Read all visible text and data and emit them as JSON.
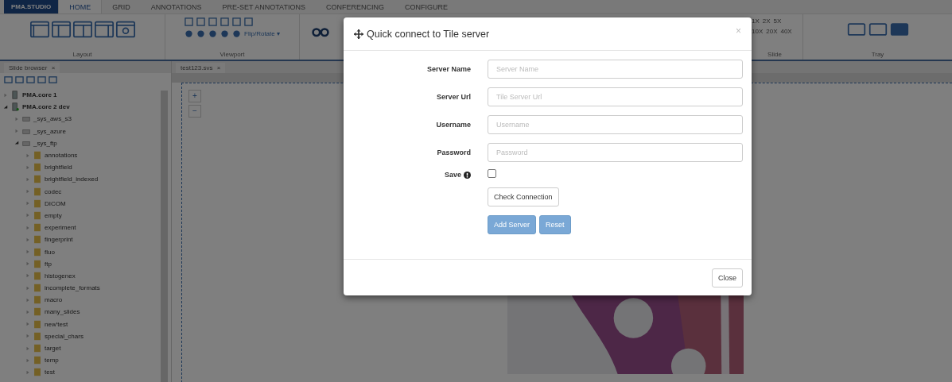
{
  "app": {
    "brand": "PMA.STUDIO"
  },
  "tabs": [
    {
      "label": "HOME",
      "selected": true
    },
    {
      "label": "GRID",
      "selected": false
    },
    {
      "label": "ANNOTATIONS",
      "selected": false
    },
    {
      "label": "PRE-SET ANNOTATIONS",
      "selected": false
    },
    {
      "label": "CONFERENCING",
      "selected": false
    },
    {
      "label": "CONFIGURE",
      "selected": false
    }
  ],
  "ribbon": {
    "layout_label": "Layout",
    "viewport_label": "Viewport",
    "flip_rotate": "Flip/Rotate ▾",
    "slide_label": "Slide",
    "tray_label": "Tray",
    "zoom_row_1": [
      "1X",
      "2X",
      "5X"
    ],
    "zoom_row_2": [
      "10X",
      "20X",
      "40X"
    ]
  },
  "sidebar": {
    "title": "Slide browser",
    "close": "×"
  },
  "document_tab": {
    "title": "test123.svs",
    "close": "×"
  },
  "tree": [
    {
      "label": "PMA.core 1",
      "kind": "server",
      "expanded": false
    },
    {
      "label": "PMA.core 2 dev",
      "kind": "server",
      "expanded": true,
      "children": [
        {
          "label": "_sys_aws_s3",
          "kind": "drive",
          "expanded": false
        },
        {
          "label": "_sys_azure",
          "kind": "drive",
          "expanded": false
        },
        {
          "label": "_sys_ftp",
          "kind": "drive",
          "expanded": true,
          "children": [
            {
              "label": "annotations",
              "kind": "folder",
              "expanded": false
            },
            {
              "label": "brightfield",
              "kind": "folder",
              "expanded": false
            },
            {
              "label": "brightfield_indexed",
              "kind": "folder",
              "expanded": false
            },
            {
              "label": "codec",
              "kind": "folder",
              "expanded": false
            },
            {
              "label": "DICOM",
              "kind": "folder",
              "expanded": false
            },
            {
              "label": "empty",
              "kind": "folder",
              "expanded": false
            },
            {
              "label": "experiment",
              "kind": "folder",
              "expanded": false
            },
            {
              "label": "fingerprint",
              "kind": "folder",
              "expanded": false
            },
            {
              "label": "fluo",
              "kind": "folder",
              "expanded": false
            },
            {
              "label": "ftp",
              "kind": "folder",
              "expanded": false
            },
            {
              "label": "histogenex",
              "kind": "folder",
              "expanded": false
            },
            {
              "label": "incomplete_formats",
              "kind": "folder",
              "expanded": false
            },
            {
              "label": "macro",
              "kind": "folder",
              "expanded": false
            },
            {
              "label": "many_slides",
              "kind": "folder",
              "expanded": false
            },
            {
              "label": "new'test",
              "kind": "folder",
              "expanded": false
            },
            {
              "label": "special_chars",
              "kind": "folder",
              "expanded": false
            },
            {
              "label": "target",
              "kind": "folder",
              "expanded": false
            },
            {
              "label": "temp",
              "kind": "folder",
              "expanded": false
            },
            {
              "label": "test",
              "kind": "folder",
              "expanded": false
            }
          ]
        }
      ]
    }
  ],
  "viewer": {
    "zoom_in": "+",
    "zoom_out": "−"
  },
  "dialog": {
    "title": "Quick connect to Tile server",
    "close": "×",
    "fields": [
      {
        "label": "Server Name",
        "placeholder": "Server Name"
      },
      {
        "label": "Server Url",
        "placeholder": "Tile Server Url"
      },
      {
        "label": "Username",
        "placeholder": "Username"
      },
      {
        "label": "Password",
        "placeholder": "Password"
      }
    ],
    "save": {
      "label": "Save",
      "checked": false
    },
    "check_button": "Check Connection",
    "primary_buttons": [
      "Add Server",
      "Reset"
    ],
    "footer_button": "Close"
  }
}
